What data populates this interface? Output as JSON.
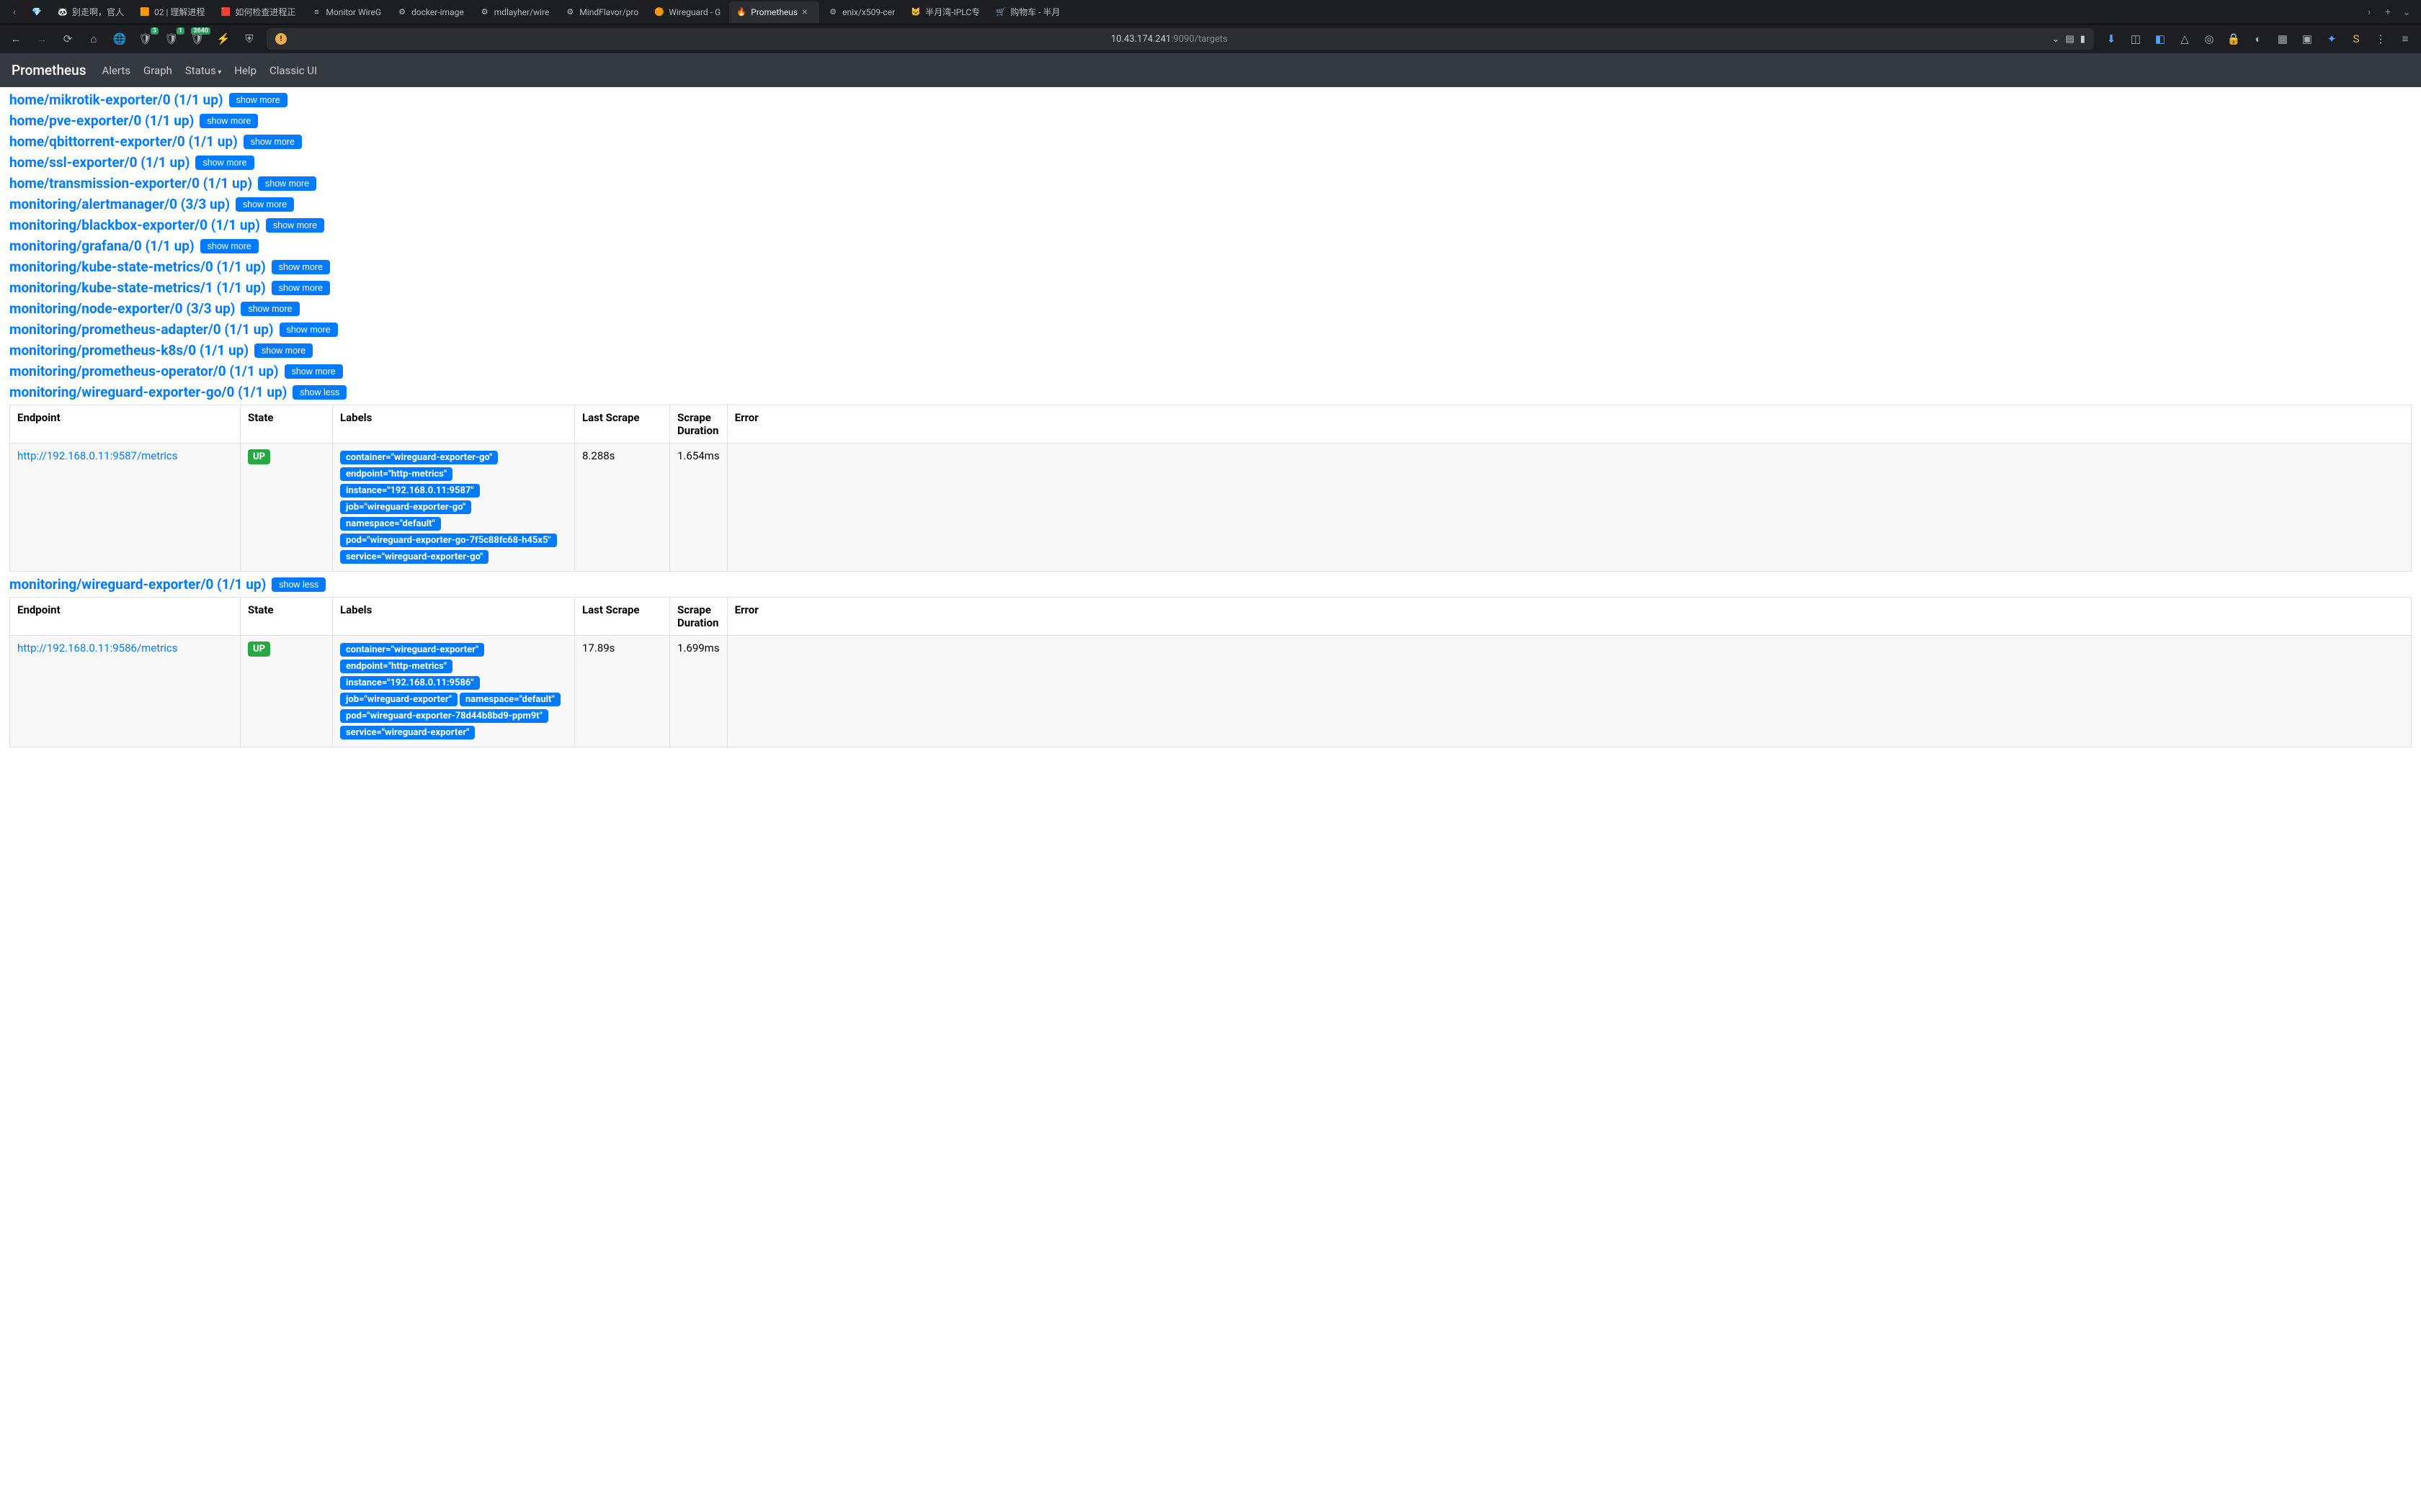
{
  "browser": {
    "tabs": [
      {
        "icon": "💎",
        "title": ""
      },
      {
        "icon": "🐼",
        "title": "别走啊，官人"
      },
      {
        "icon": "🟧",
        "title": "02 | 理解进程"
      },
      {
        "icon": "🟥",
        "title": "如何检查进程正"
      },
      {
        "icon": "≡",
        "title": "Monitor WireG"
      },
      {
        "icon": "⚙",
        "title": "docker-image"
      },
      {
        "icon": "⚙",
        "title": "mdlayher/wire"
      },
      {
        "icon": "⚙",
        "title": "MindFlavor/pro"
      },
      {
        "icon": "🟠",
        "title": "Wireguard - G"
      },
      {
        "icon": "🔥",
        "title": "Prometheus",
        "active": true
      },
      {
        "icon": "⚙",
        "title": "enix/x509-cer"
      },
      {
        "icon": "🐱",
        "title": "半月湾-IPLC专"
      },
      {
        "icon": "🛒",
        "title": "购物车 - 半月"
      }
    ],
    "url_host": "10.43.174.241",
    "url_rest": ":9090/targets",
    "badges": {
      "ext1": "3",
      "ext2": "1",
      "ext3": "3640"
    }
  },
  "nav": {
    "brand": "Prometheus",
    "links": [
      "Alerts",
      "Graph",
      "Status",
      "Help",
      "Classic UI"
    ]
  },
  "groups": [
    {
      "title": "home/mikrotik-exporter/0 (1/1 up)",
      "btn": "show more"
    },
    {
      "title": "home/pve-exporter/0 (1/1 up)",
      "btn": "show more"
    },
    {
      "title": "home/qbittorrent-exporter/0 (1/1 up)",
      "btn": "show more"
    },
    {
      "title": "home/ssl-exporter/0 (1/1 up)",
      "btn": "show more"
    },
    {
      "title": "home/transmission-exporter/0 (1/1 up)",
      "btn": "show more"
    },
    {
      "title": "monitoring/alertmanager/0 (3/3 up)",
      "btn": "show more"
    },
    {
      "title": "monitoring/blackbox-exporter/0 (1/1 up)",
      "btn": "show more"
    },
    {
      "title": "monitoring/grafana/0 (1/1 up)",
      "btn": "show more"
    },
    {
      "title": "monitoring/kube-state-metrics/0 (1/1 up)",
      "btn": "show more"
    },
    {
      "title": "monitoring/kube-state-metrics/1 (1/1 up)",
      "btn": "show more"
    },
    {
      "title": "monitoring/node-exporter/0 (3/3 up)",
      "btn": "show more"
    },
    {
      "title": "monitoring/prometheus-adapter/0 (1/1 up)",
      "btn": "show more"
    },
    {
      "title": "monitoring/prometheus-k8s/0 (1/1 up)",
      "btn": "show more"
    },
    {
      "title": "monitoring/prometheus-operator/0 (1/1 up)",
      "btn": "show more"
    },
    {
      "title": "monitoring/wireguard-exporter-go/0 (1/1 up)",
      "btn": "show less",
      "table": {
        "headers": [
          "Endpoint",
          "State",
          "Labels",
          "Last Scrape",
          "Scrape Duration",
          "Error"
        ],
        "rows": [
          {
            "endpoint": "http://192.168.0.11:9587/metrics",
            "state": "UP",
            "labels": [
              "container=\"wireguard-exporter-go\"",
              "endpoint=\"http-metrics\"",
              "instance=\"192.168.0.11:9587\"",
              "job=\"wireguard-exporter-go\"",
              "namespace=\"default\"",
              "pod=\"wireguard-exporter-go-7f5c88fc68-h45x5\"",
              "service=\"wireguard-exporter-go\""
            ],
            "last_scrape": "8.288s",
            "duration": "1.654ms",
            "error": ""
          }
        ]
      }
    },
    {
      "title": "monitoring/wireguard-exporter/0 (1/1 up)",
      "btn": "show less",
      "table": {
        "headers": [
          "Endpoint",
          "State",
          "Labels",
          "Last Scrape",
          "Scrape Duration",
          "Error"
        ],
        "rows": [
          {
            "endpoint": "http://192.168.0.11:9586/metrics",
            "state": "UP",
            "labels": [
              "container=\"wireguard-exporter\"",
              "endpoint=\"http-metrics\"",
              "instance=\"192.168.0.11:9586\"",
              "job=\"wireguard-exporter\"",
              "namespace=\"default\"",
              "pod=\"wireguard-exporter-78d44b8bd9-ppm9t\"",
              "service=\"wireguard-exporter\""
            ],
            "last_scrape": "17.89s",
            "duration": "1.699ms",
            "error": ""
          }
        ]
      }
    }
  ]
}
